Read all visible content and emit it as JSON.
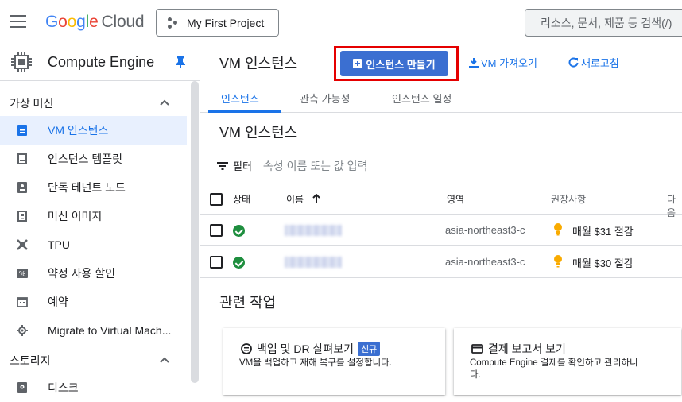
{
  "topbar": {
    "logo": {
      "g1": "G",
      "g2": "o",
      "g3": "o",
      "g4": "g",
      "g5": "l",
      "g6": "e",
      "cloud": "Cloud"
    },
    "project": "My First Project",
    "search_placeholder": "리소스, 문서, 제품 등 검색(/)"
  },
  "sidebar": {
    "title": "Compute Engine",
    "section_vm": "가상 머신",
    "items": [
      {
        "label": "VM 인스턴스",
        "icon": "vm-instance-icon"
      },
      {
        "label": "인스턴스 템플릿",
        "icon": "template-icon"
      },
      {
        "label": "단독 테넌트 노드",
        "icon": "tenant-node-icon"
      },
      {
        "label": "머신 이미지",
        "icon": "machine-image-icon"
      },
      {
        "label": "TPU",
        "icon": "tpu-icon"
      },
      {
        "label": "약정 사용 할인",
        "icon": "percent-icon"
      },
      {
        "label": "예약",
        "icon": "calendar-icon"
      },
      {
        "label": "Migrate to Virtual Mach...",
        "icon": "migrate-icon"
      }
    ],
    "section_storage": "스토리지",
    "storage_items": [
      {
        "label": "디스크",
        "icon": "disk-icon"
      }
    ]
  },
  "header": {
    "title": "VM 인스턴스",
    "create_label": "인스턴스 만들기",
    "import_label": "VM 가져오기",
    "refresh_label": "새로고침"
  },
  "tabs": [
    {
      "label": "인스턴스",
      "active": true
    },
    {
      "label": "관측 가능성",
      "active": false
    },
    {
      "label": "인스턴스 일정",
      "active": false
    }
  ],
  "table": {
    "title": "VM 인스턴스",
    "filter_label": "필터",
    "filter_placeholder": "속성 이름 또는 값 입력",
    "columns": [
      "상태",
      "이름",
      "영역",
      "권장사항",
      "다음"
    ],
    "rows": [
      {
        "zone": "asia-northeast3-c",
        "recommendation": "매월 $31 절감"
      },
      {
        "zone": "asia-northeast3-c",
        "recommendation": "매월 $30 절감"
      }
    ]
  },
  "related": {
    "title": "관련 작업",
    "cards": [
      {
        "title": "백업 및 DR 살펴보기",
        "badge": "신규",
        "desc": "VM을 백업하고 재해 복구를 설정합니다."
      },
      {
        "title": "결제 보고서 보기",
        "desc": "Compute Engine 결제를 확인하고 관리하니\n다."
      }
    ]
  },
  "colors": {
    "accent": "#1a73e8",
    "primary_button": "#3b6fd1",
    "highlight": "#e50000",
    "ok": "#1e8e3e",
    "bulb": "#f9ab00"
  }
}
